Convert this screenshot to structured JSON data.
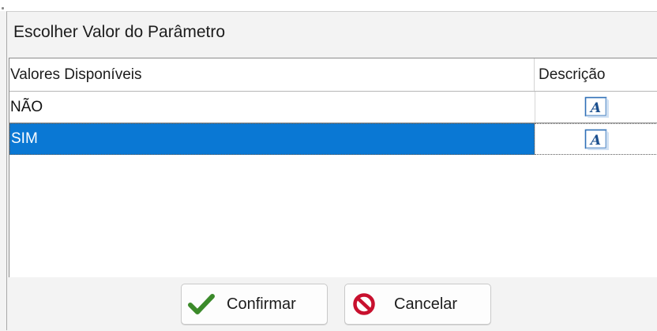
{
  "dialog": {
    "title": "Escolher Valor do Parâmetro"
  },
  "grid": {
    "columns": [
      "Valores Disponíveis",
      "Descrição"
    ],
    "rows": [
      {
        "value": "NÃO",
        "description_icon": "text-style-icon",
        "selected": false
      },
      {
        "value": "SIM",
        "description_icon": "text-style-icon",
        "selected": true
      }
    ]
  },
  "buttons": {
    "confirm_label": "Confirmar",
    "confirm_icon": "checkmark-icon",
    "cancel_label": "Cancelar",
    "cancel_icon": "prohibited-icon"
  },
  "colors": {
    "selection": "#0a78d4",
    "checkmark": "#3b8a2a",
    "cancel": "#c8102e"
  }
}
